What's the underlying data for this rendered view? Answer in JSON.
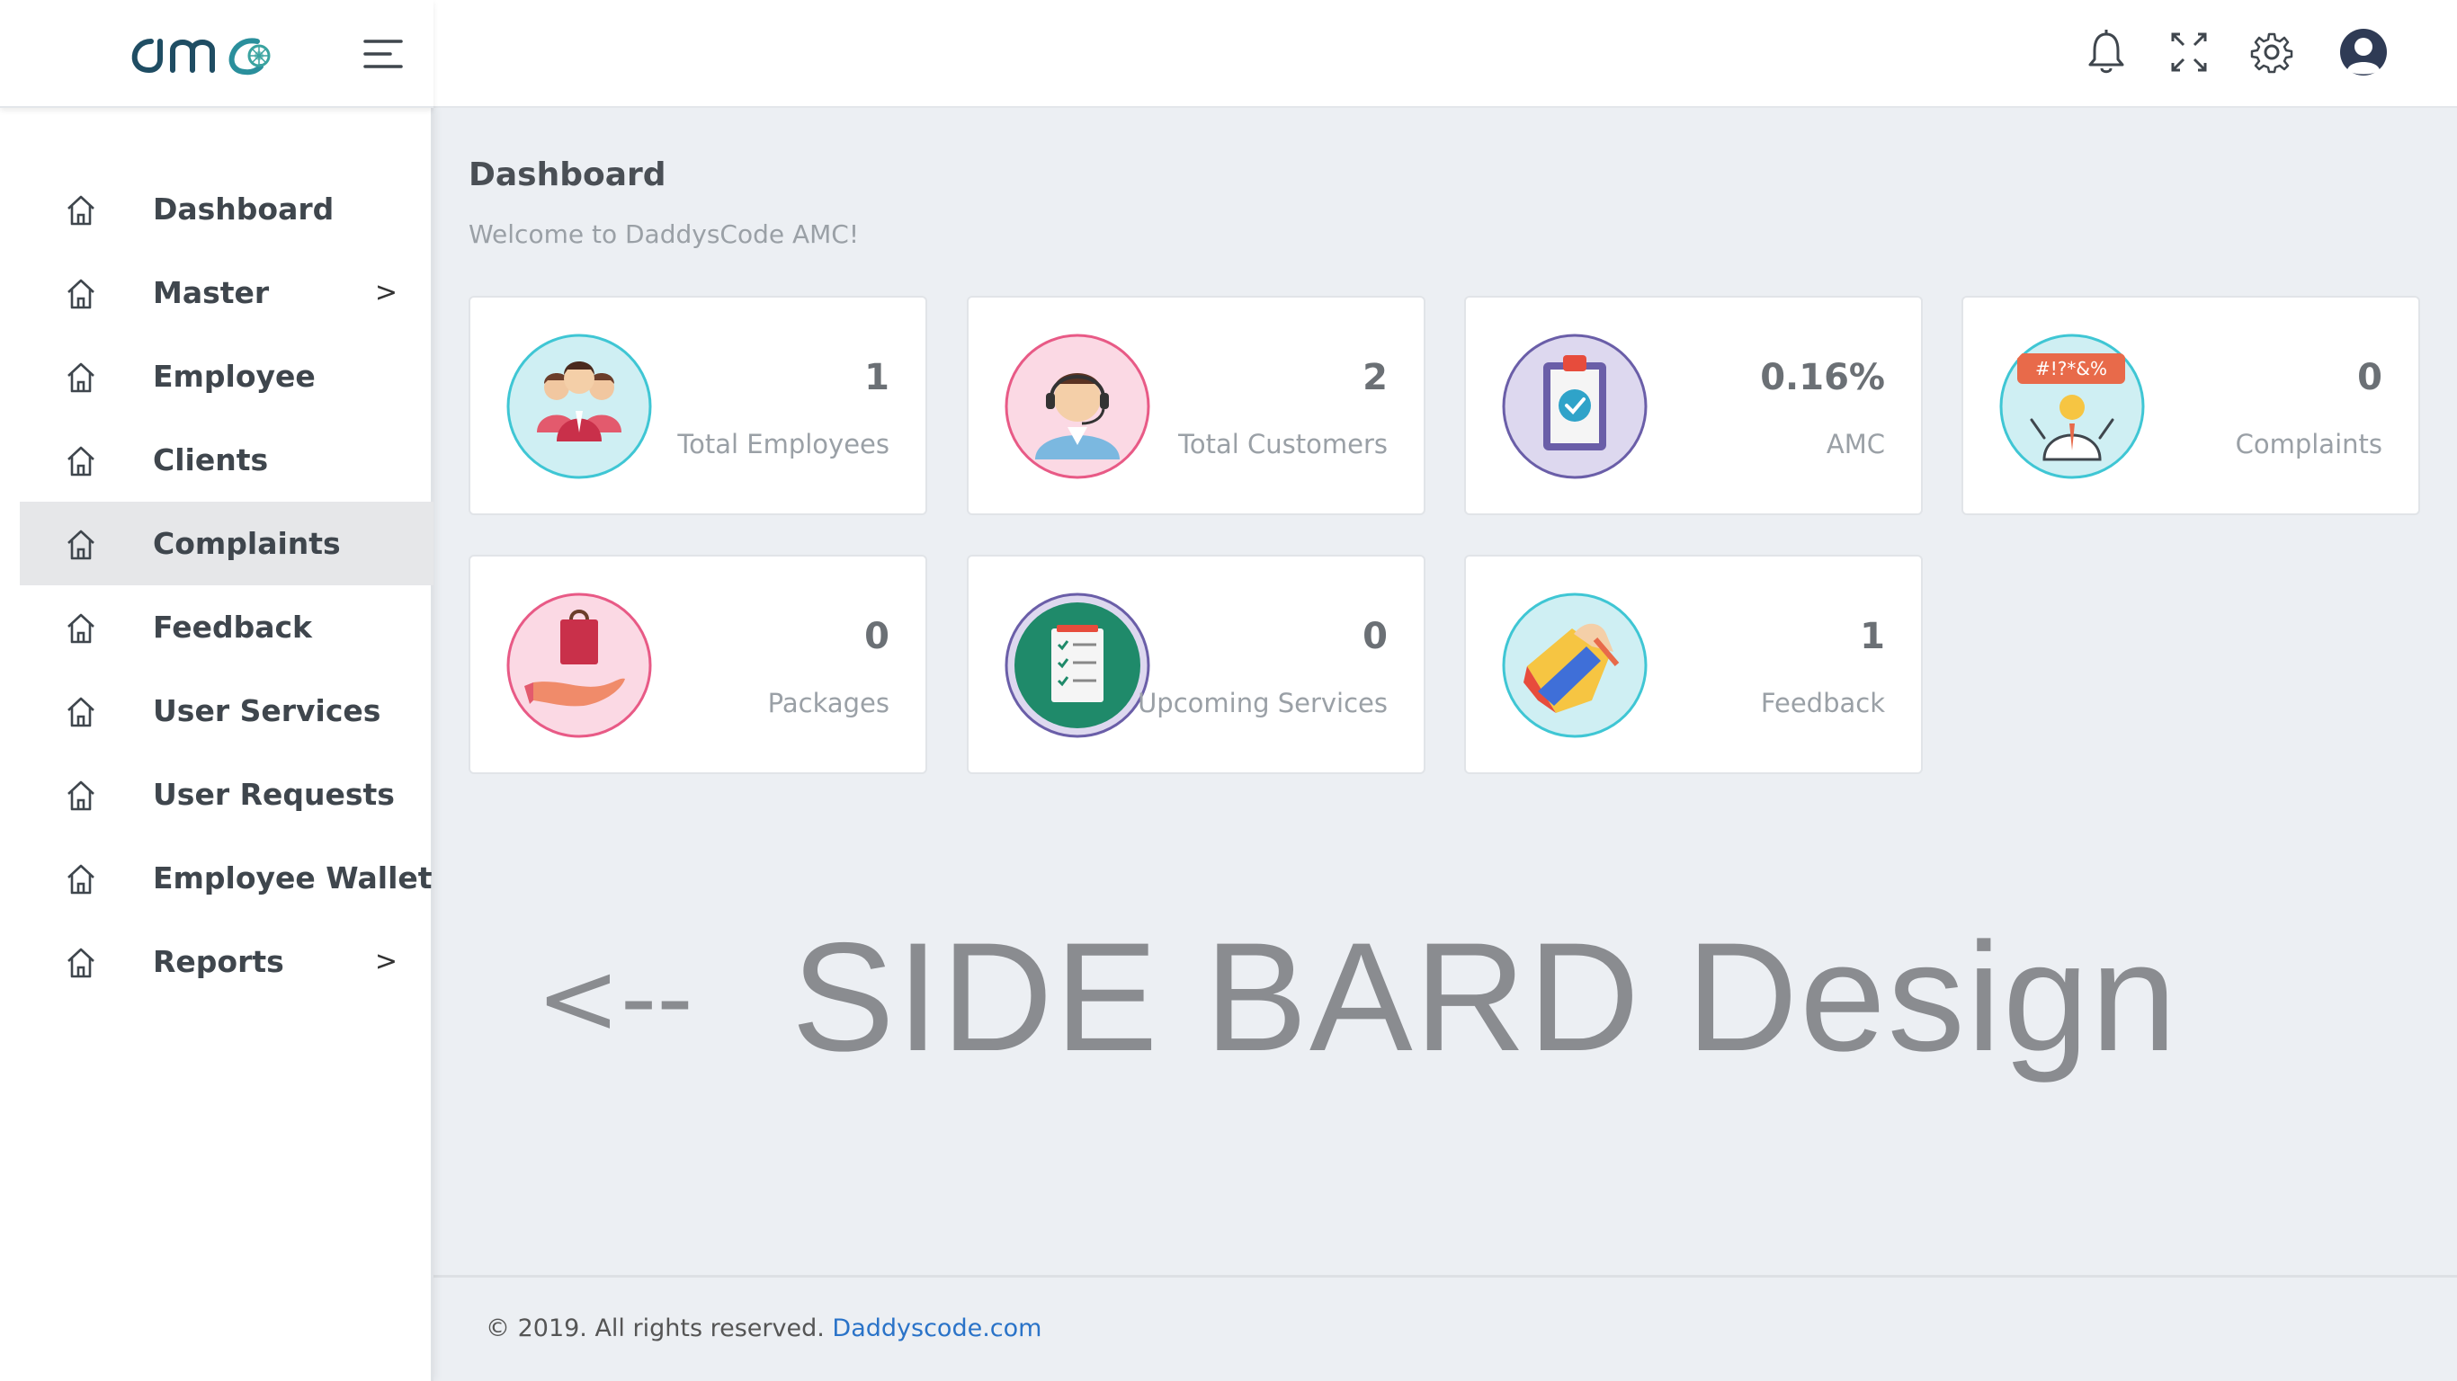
{
  "brand": {
    "logo_text": "amc"
  },
  "header": {
    "icons": [
      "bell-icon",
      "fullscreen-icon",
      "gear-icon",
      "user-avatar-icon"
    ]
  },
  "sidebar": {
    "items": [
      {
        "label": "Dashboard",
        "icon": "home-icon",
        "has_submenu": false,
        "active": false
      },
      {
        "label": "Master",
        "icon": "home-icon",
        "has_submenu": true,
        "arrow": ">",
        "active": false
      },
      {
        "label": "Employee",
        "icon": "home-icon",
        "has_submenu": false,
        "active": false
      },
      {
        "label": "Clients",
        "icon": "home-icon",
        "has_submenu": false,
        "active": false
      },
      {
        "label": "Complaints",
        "icon": "home-icon",
        "has_submenu": false,
        "active": true
      },
      {
        "label": "Feedback",
        "icon": "home-icon",
        "has_submenu": false,
        "active": false
      },
      {
        "label": "User Services",
        "icon": "home-icon",
        "has_submenu": false,
        "active": false
      },
      {
        "label": "User Requests",
        "icon": "home-icon",
        "has_submenu": false,
        "active": false
      },
      {
        "label": "Employee Wallet",
        "icon": "home-icon",
        "has_submenu": false,
        "active": false
      },
      {
        "label": "Reports",
        "icon": "home-icon",
        "has_submenu": true,
        "arrow": ">",
        "active": false
      }
    ]
  },
  "main": {
    "title": "Dashboard",
    "welcome": "Welcome to DaddysCode AMC!",
    "cards": [
      {
        "value": "1",
        "label": "Total Employees",
        "icon": "team-icon",
        "ring": "#3fc6d4",
        "bg": "#cfeff3"
      },
      {
        "value": "2",
        "label": "Total Customers",
        "icon": "support-agent-icon",
        "ring": "#e85a86",
        "bg": "#fbd9e4"
      },
      {
        "value": "0.16%",
        "label": "AMC",
        "icon": "clipboard-check-icon",
        "ring": "#6a5ea8",
        "bg": "#ddd8ef"
      },
      {
        "value": "0",
        "label": "Complaints",
        "icon": "angry-person-icon",
        "ring": "#3fc6d4",
        "bg": "#cfeff3"
      },
      {
        "value": "0",
        "label": "Packages",
        "icon": "hand-package-icon",
        "ring": "#e85a86",
        "bg": "#fbd9e4"
      },
      {
        "value": "0",
        "label": "Upcoming Services",
        "icon": "checklist-icon",
        "ring": "#6a5ea8",
        "bg": "#ddd8ef"
      },
      {
        "value": "1",
        "label": "Feedback",
        "icon": "thumbs-up-icon",
        "ring": "#3fc6d4",
        "bg": "#cfeff3"
      }
    ],
    "caption_arrow": "<--",
    "caption": "SIDE BARD Design"
  },
  "footer": {
    "text": "© 2019. All rights reserved.",
    "link": "Daddyscode.com"
  }
}
